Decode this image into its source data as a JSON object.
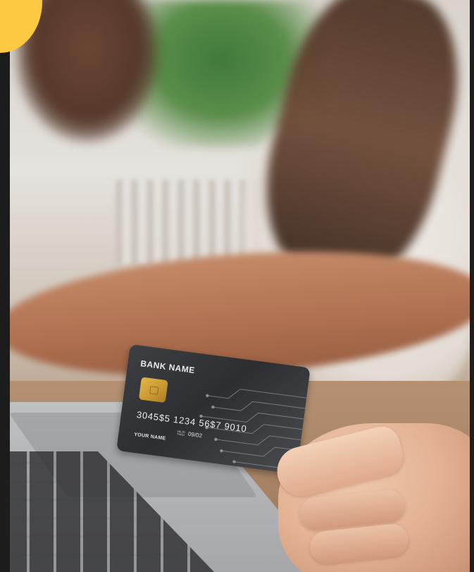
{
  "card": {
    "bank_name": "BANK NAME",
    "number": "3045$5  1234  56$7  9010",
    "valid_label": "VALID THRU",
    "expiry": "09/02",
    "holder": "YOUR NAME"
  },
  "colors": {
    "accent_yellow": "#fdc842",
    "frame": "#1c1c1c",
    "card_body": "#323438",
    "chip_gold": "#d4a23a"
  },
  "icons": {
    "card_chip": "chip-icon"
  }
}
